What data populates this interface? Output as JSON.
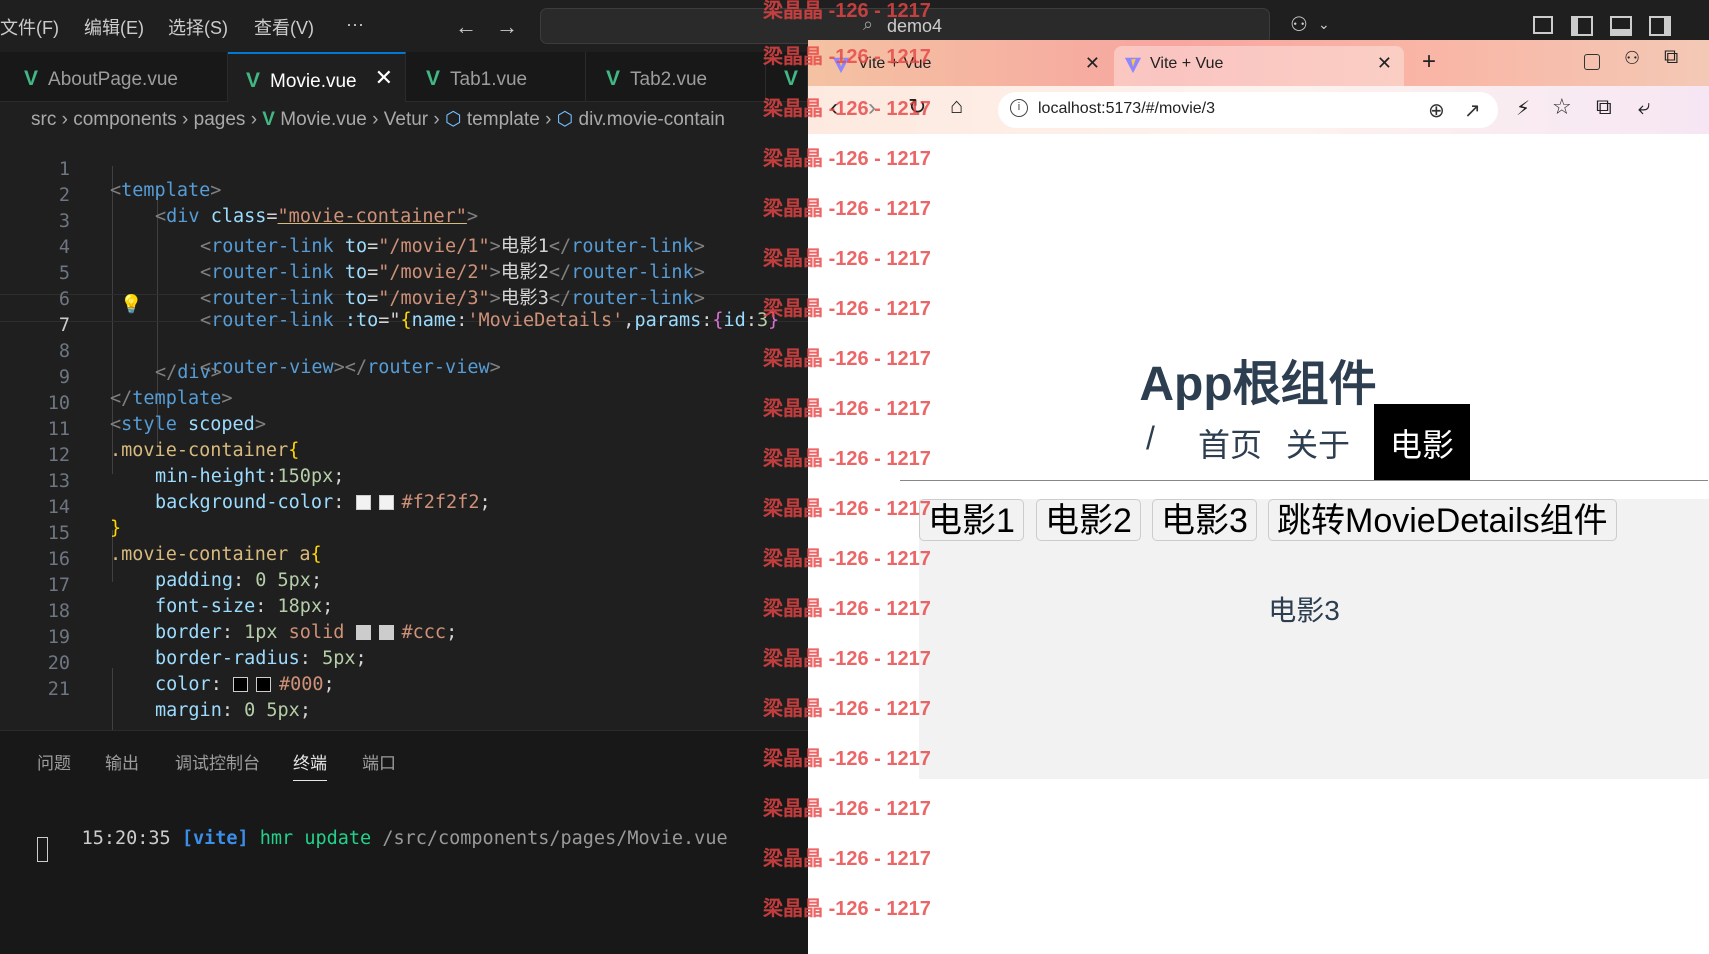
{
  "menu": [
    "文件(F)",
    "编辑(E)",
    "选择(S)",
    "查看(V)",
    "···"
  ],
  "search": {
    "label": "demo4"
  },
  "editor_tabs": [
    {
      "label": "AboutPage.vue",
      "active": false
    },
    {
      "label": "Movie.vue",
      "active": true
    },
    {
      "label": "Tab1.vue",
      "active": false
    },
    {
      "label": "Tab2.vue",
      "active": false
    }
  ],
  "breadcrumb": [
    "src",
    "components",
    "pages",
    "Movie.vue",
    "Vetur",
    "template",
    "div.movie-contain"
  ],
  "code_lines": [
    {
      "n": "1"
    },
    {
      "n": "2"
    },
    {
      "n": "3"
    },
    {
      "n": "4"
    },
    {
      "n": "5"
    },
    {
      "n": "6"
    },
    {
      "n": "7"
    },
    {
      "n": "8"
    },
    {
      "n": "9"
    },
    {
      "n": "10"
    },
    {
      "n": "11"
    },
    {
      "n": "12"
    },
    {
      "n": "13"
    },
    {
      "n": "14"
    },
    {
      "n": "15"
    },
    {
      "n": "16"
    },
    {
      "n": "17"
    },
    {
      "n": "18"
    },
    {
      "n": "19"
    },
    {
      "n": "20"
    },
    {
      "n": "21"
    }
  ],
  "code": {
    "l1_tag": "template",
    "l2_tag": "div",
    "l2_attr": "class",
    "l2_val": "\"movie-container\"",
    "l3_tag": "router-link",
    "l3_attr": "to",
    "l3_val": "\"/movie/1\"",
    "l3_text": "电影1",
    "l4_tag": "router-link",
    "l4_attr": "to",
    "l4_val": "\"/movie/2\"",
    "l4_text": "电影2",
    "l5_tag": "router-link",
    "l5_attr": "to",
    "l5_val": "\"/movie/3\"",
    "l5_text": "电影3",
    "l6_tag": "router-link",
    "l6_attr": ":to",
    "l6_key1": "name",
    "l6_val1": "'MovieDetails'",
    "l6_key2": "params",
    "l6_key3": "id",
    "l6_num": "3",
    "l7_tag": "router-view",
    "l8_tag": "div",
    "l9_tag": "template",
    "l10_tag": "style",
    "l10_attr": "scoped",
    "l11_sel": ".movie-container",
    "l12_prop": "min-height",
    "l12_val": "150px",
    "l13_prop": "background-color",
    "l13_val": "#f2f2f2",
    "l15_sel": ".movie-container a",
    "l16_prop": "padding",
    "l16_val": "0 5px",
    "l17_prop": "font-size",
    "l17_val": "18px",
    "l18_prop": "border",
    "l18_val1": "1px",
    "l18_val2": "solid",
    "l18_val3": "#ccc",
    "l19_prop": "border-radius",
    "l19_val": "5px",
    "l20_prop": "color",
    "l20_val": "#000",
    "l21_prop": "margin",
    "l21_val": "0 5px"
  },
  "panel": {
    "tabs": [
      "问题",
      "输出",
      "调试控制台",
      "终端",
      "端口"
    ],
    "active_tab": "终端",
    "terminal": {
      "time": "15:20:35",
      "tag": "[vite]",
      "cmd": "hmr update",
      "path": "/src/components/pages/Movie.vue"
    }
  },
  "browser": {
    "tabs": [
      {
        "label": "Vite + Vue",
        "active": false
      },
      {
        "label": "Vite + Vue",
        "active": true
      }
    ],
    "url": "localhost:5173/#/movie/3",
    "app_title": "App根组件",
    "nav": [
      "/",
      "首页",
      "关于",
      "电影"
    ],
    "movie_links": [
      "电影1",
      "电影2",
      "电影3",
      "跳转MovieDetails组件"
    ],
    "movie_detail": "电影3"
  },
  "watermark": {
    "name": "梁晶晶",
    "code": "-126 - 1217"
  }
}
